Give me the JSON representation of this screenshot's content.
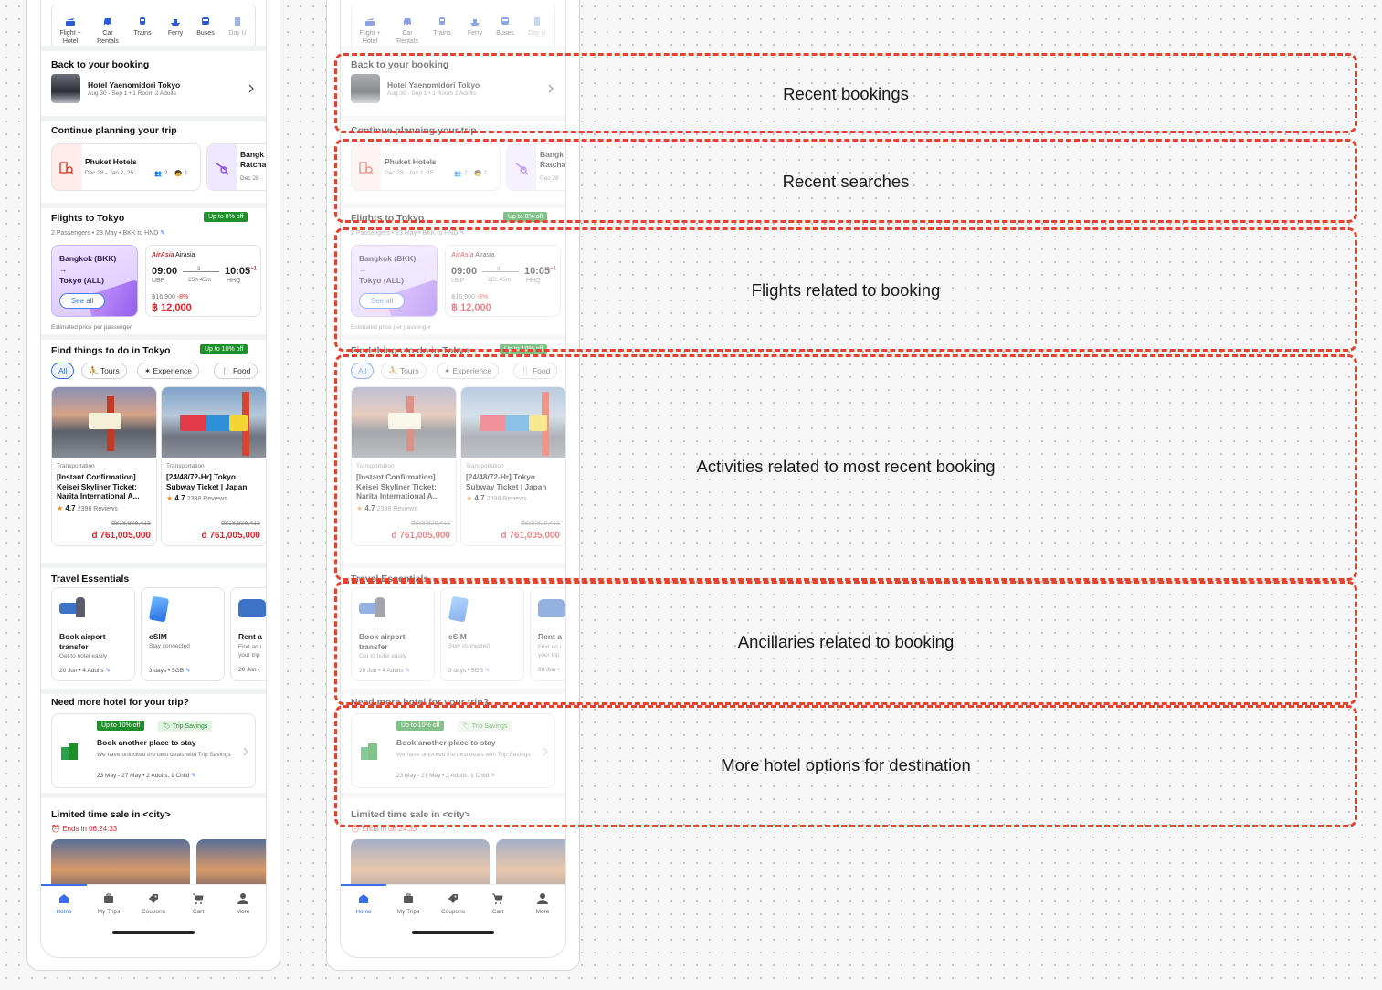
{
  "categories": [
    {
      "label": "Flight +\nHotel",
      "icon": "flight-hotel-icon"
    },
    {
      "label": "Car\nRentals",
      "icon": "car-icon"
    },
    {
      "label": "Trains",
      "icon": "train-icon"
    },
    {
      "label": "Ferry",
      "icon": "ferry-icon"
    },
    {
      "label": "Buses",
      "icon": "bus-icon"
    },
    {
      "label": "Day U",
      "icon": "day-use-icon"
    }
  ],
  "booking": {
    "section_title": "Back to your booking",
    "hotel_name": "Hotel Yaenomidori Tokyo",
    "details": "Aug 30 - Sep 1 • 1 Room 2 Adults"
  },
  "planning": {
    "section_title": "Continue planning your trip",
    "card1_title": "Phuket Hotels",
    "card1_dates": "Dec 28 - Jan 2, 25",
    "card1_guests": "2",
    "card1_children": "1",
    "card2_title": "Bangk",
    "card2_sub": "Ratcha",
    "card2_dates": "Dec 28"
  },
  "flights": {
    "section_title": "Flights to Tokyo",
    "badge": "Up to 8% off",
    "subtitle": "2 Passengers • 23 May • BKK to HND",
    "promo_from": "Bangkok (BKK)",
    "promo_arrow": "→",
    "promo_to": "Tokyo (ALL)",
    "see_all": "See all",
    "airline": "Airasia",
    "depart_time": "09:00",
    "depart_code": "UBP",
    "stops": "3",
    "duration": "25h 45m",
    "arrive_time": "10:05",
    "arrive_plus": "+1",
    "arrive_code": "HHQ",
    "old_price": "฿16,900",
    "discount": "-8%",
    "price": "฿ 12,000",
    "footnote": "Estimated price per passenger"
  },
  "activities": {
    "section_title": "Find things to do in Tokyo",
    "badge": "Up to 10% off",
    "chips": [
      "All",
      "Tours",
      "Experience",
      "Food"
    ],
    "items": [
      {
        "category": "Transportation",
        "title": "[Instant Confirmation] Keisei Skyliner Ticket: Narita International A...",
        "rating": "4.7",
        "reviews": "2398 Reviews",
        "old_price": "đ818,926,415",
        "price": "đ 761,005,000"
      },
      {
        "category": "Transportation",
        "title": "[24/48/72-Hr] Tokyo Subway Ticket | Japan",
        "rating": "4.7",
        "reviews": "2398 Reviews",
        "old_price": "đ818,926,415",
        "price": "đ 761,005,000"
      }
    ]
  },
  "essentials": {
    "section_title": "Travel Essentials",
    "items": [
      {
        "title": "Book airport transfer",
        "subtitle": "Get to hotel easily",
        "meta": "20 Jun • 4 Adults"
      },
      {
        "title": "eSIM",
        "subtitle": "Stay connected",
        "meta": "3 days • 5GB"
      },
      {
        "title": "Rent a",
        "subtitle": "Find an i your trip",
        "meta": "20 Jun •"
      }
    ]
  },
  "more_hotel": {
    "section_title": "Need more hotel for your trip?",
    "badge1": "Up to 10% off",
    "badge2": "Trip Savings",
    "title": "Book another place to stay",
    "desc": "We have unlocked the best deals with Trip Savings",
    "meta": "23 May - 27 May • 2 Adults, 1 Child"
  },
  "sale": {
    "section_title": "Limited time sale in <city>",
    "timer": "Ends in 06:24:33"
  },
  "tabs": [
    "Home",
    "My Trips",
    "Coupons",
    "Cart",
    "More"
  ],
  "annotations": [
    "Recent bookings",
    "Recent searches",
    "Flights related to booking",
    "Activities related to most recent booking",
    "Ancillaries related to booking",
    "More hotel options for destination"
  ],
  "colors": {
    "annotation": "#e5432f",
    "accent": "#3a6ef0",
    "discount_green": "#1f8f2c",
    "price_red": "#e0262b"
  }
}
